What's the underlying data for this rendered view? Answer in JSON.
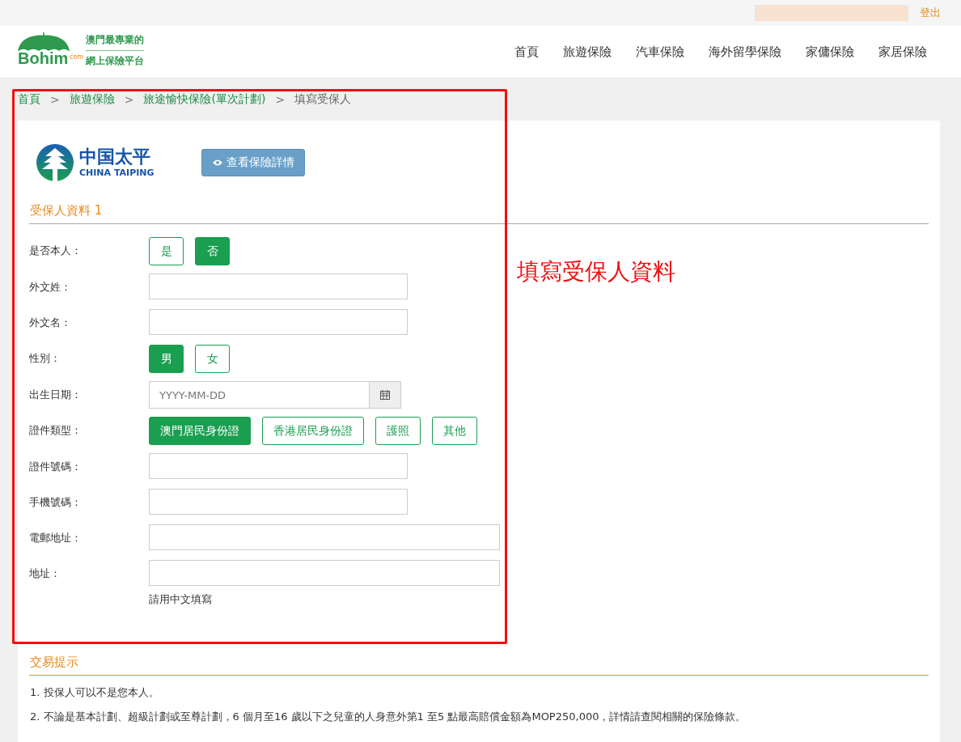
{
  "top_bar": {
    "logout": "登出"
  },
  "header": {
    "logo_line_1": "澳門最專業的",
    "logo_line_2": "網上保險平台",
    "logo_word": "Bohim",
    "logo_dot_com": "com",
    "nav": [
      {
        "label": "首頁"
      },
      {
        "label": "旅遊保險"
      },
      {
        "label": "汽車保險"
      },
      {
        "label": "海外留學保險"
      },
      {
        "label": "家傭保險"
      },
      {
        "label": "家居保險"
      }
    ]
  },
  "breadcrumb": [
    {
      "label": "首頁",
      "link": true
    },
    {
      "separator": ">",
      "label": "旅遊保險",
      "link": true
    },
    {
      "separator": ">",
      "label": "旅途愉快保險(單次計劃)",
      "link": true
    },
    {
      "separator": ">",
      "label": "填寫受保人",
      "link": false
    }
  ],
  "insurer": {
    "name_zh": "中国太平",
    "name_en": "CHINA TAIPING",
    "details_button": "查看保險詳情"
  },
  "section_title": "受保人資料 1",
  "fields": [
    {
      "kind": "toggle",
      "label": "是否本人：",
      "options": [
        {
          "label": "是",
          "selected": false
        },
        {
          "label": "否",
          "selected": true
        }
      ]
    },
    {
      "kind": "text",
      "label": "外文姓："
    },
    {
      "kind": "text",
      "label": "外文名："
    },
    {
      "kind": "toggle",
      "label": "性別：",
      "options": [
        {
          "label": "男",
          "selected": true
        },
        {
          "label": "女",
          "selected": false
        }
      ]
    },
    {
      "kind": "date",
      "label": "出生日期：",
      "placeholder": "YYYY-MM-DD"
    },
    {
      "kind": "toggle",
      "label": "證件類型：",
      "options": [
        {
          "label": "澳門居民身份證",
          "selected": true
        },
        {
          "label": "香港居民身份證",
          "selected": false
        },
        {
          "label": "護照",
          "selected": false
        },
        {
          "label": "其他",
          "selected": false
        }
      ]
    },
    {
      "kind": "text",
      "label": "證件號碼："
    },
    {
      "kind": "text",
      "label": "手機號碼："
    },
    {
      "kind": "wide",
      "label": "電郵地址："
    },
    {
      "kind": "wide",
      "label": "地址：",
      "hint": "請用中文填寫"
    }
  ],
  "annotation": "填寫受保人資料",
  "tips": {
    "title": "交易提示",
    "items": [
      "1. 投保人可以不是您本人。",
      "2. 不論是基本計劃、超級計劃或至尊計劃，6 個月至16 歲以下之兒童的人身意外第1 至5 點最高賠償金額為MOP250,000，詳情請查閱相關的保險條款。"
    ]
  }
}
